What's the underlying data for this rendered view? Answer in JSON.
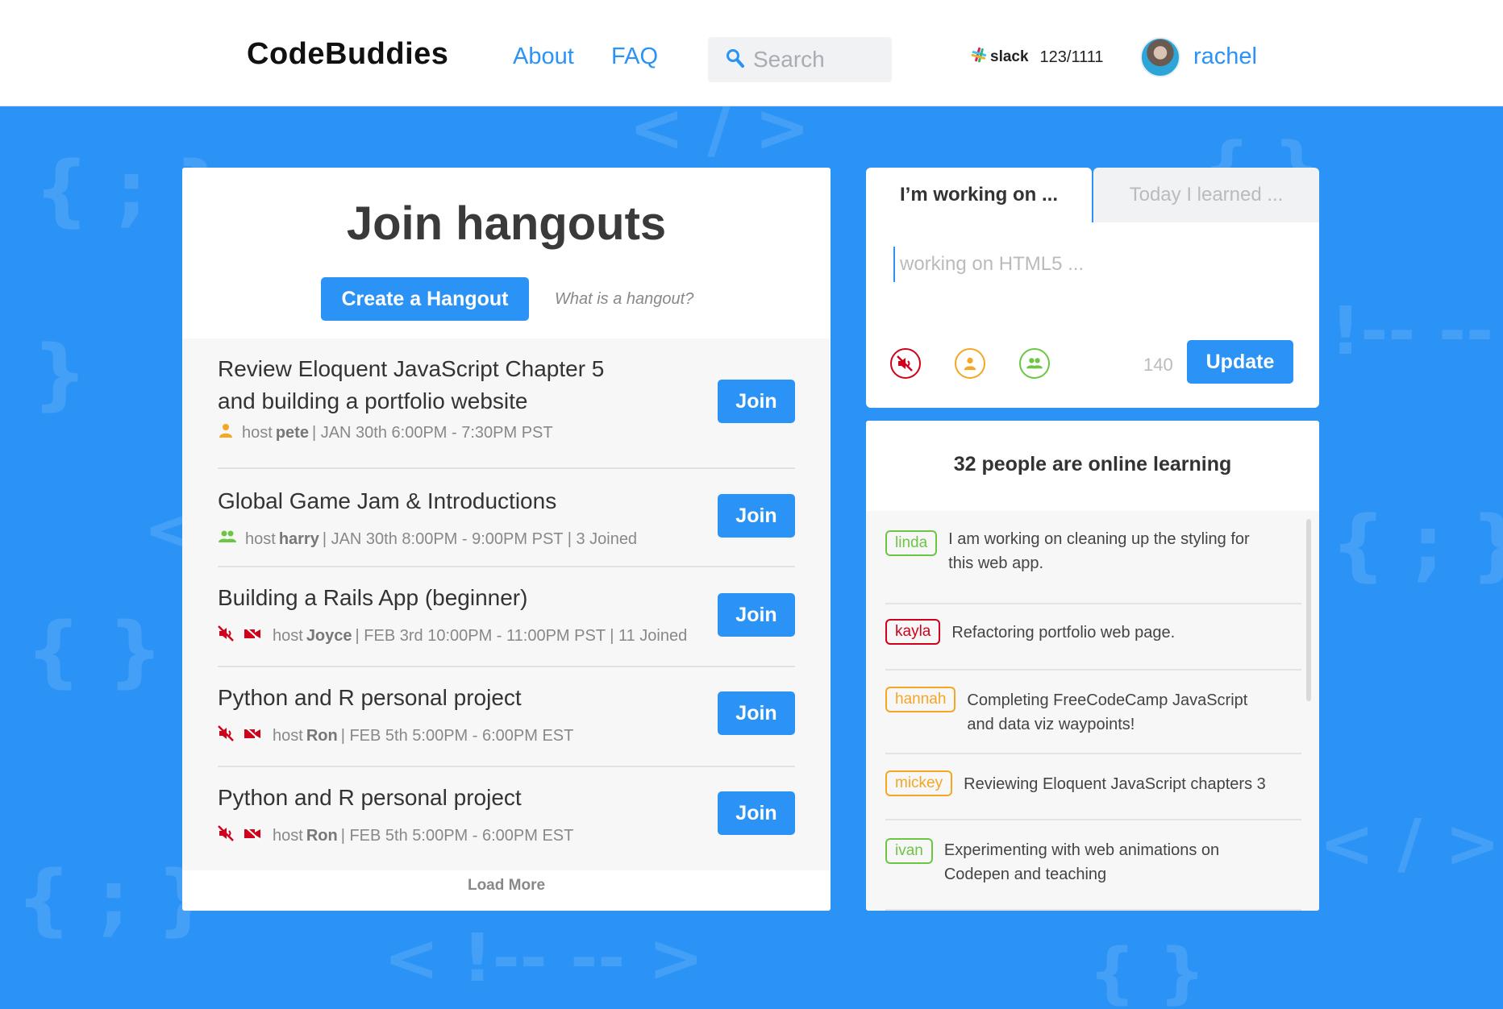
{
  "header": {
    "logo": "CodeBuddies",
    "nav": [
      {
        "label": "About"
      },
      {
        "label": "FAQ"
      }
    ],
    "search": {
      "placeholder": "Search",
      "icon": "search-icon"
    },
    "slack": {
      "label": "slack",
      "count": "123/1111"
    },
    "user": {
      "name": "rachel"
    }
  },
  "hangouts": {
    "title": "Join hangouts",
    "create_label": "Create a Hangout",
    "what_link": "What is a hangout?",
    "join_label": "Join",
    "load_more": "Load More",
    "items": [
      {
        "title": "Review Eloquent JavaScript Chapter 5 and building a portfolio website",
        "host_prefix": "host",
        "host": "pete",
        "details": "| JAN 30th 6:00PM - 7:30PM PST",
        "icons": [
          "solo-person-icon"
        ]
      },
      {
        "title": "Global Game Jam & Introductions",
        "host_prefix": "host",
        "host": "harry",
        "details": "| JAN 30th 8:00PM - 9:00PM PST | 3 Joined",
        "icons": [
          "group-icon"
        ]
      },
      {
        "title": "Building a Rails App (beginner)",
        "host_prefix": "host",
        "host": "Joyce",
        "details": "| FEB 3rd 10:00PM - 11:00PM PST | 11 Joined",
        "icons": [
          "muted-icon",
          "video-off-icon"
        ]
      },
      {
        "title": "Python and R personal project",
        "host_prefix": "host",
        "host": "Ron",
        "details": "| FEB 5th 5:00PM - 6:00PM EST",
        "icons": [
          "muted-icon",
          "video-off-icon"
        ]
      },
      {
        "title": "Python and R personal project",
        "host_prefix": "host",
        "host": "Ron",
        "details": "| FEB 5th 5:00PM - 6:00PM EST",
        "icons": [
          "muted-icon",
          "video-off-icon"
        ]
      }
    ]
  },
  "status": {
    "tabs": [
      {
        "label": "I’m working on ..."
      },
      {
        "label": "Today I learned ..."
      }
    ],
    "placeholder": "working on HTML5 ...",
    "char_count": "140",
    "update_label": "Update",
    "icons": [
      "muted-icon",
      "solo-person-icon",
      "group-icon"
    ]
  },
  "online": {
    "title": "32 people are online learning",
    "items": [
      {
        "user": "linda",
        "message": "I am working on cleaning up the styling for this web app.",
        "color": "#6cc644"
      },
      {
        "user": "kayla",
        "message": "Refactoring portfolio web page.",
        "color": "#d0021b"
      },
      {
        "user": "hannah",
        "message": "Completing FreeCodeCamp JavaScript and data viz waypoints!",
        "color": "#f5a623"
      },
      {
        "user": "mickey",
        "message": "Reviewing Eloquent JavaScript chapters 3",
        "color": "#f5a623"
      },
      {
        "user": "ivan",
        "message": "Experimenting with web animations on Codepen and teaching",
        "color": "#6cc644"
      }
    ]
  },
  "colors": {
    "accent": "#2b93f5",
    "red": "#d0021b",
    "orange": "#f5a623",
    "green": "#6cc644"
  }
}
